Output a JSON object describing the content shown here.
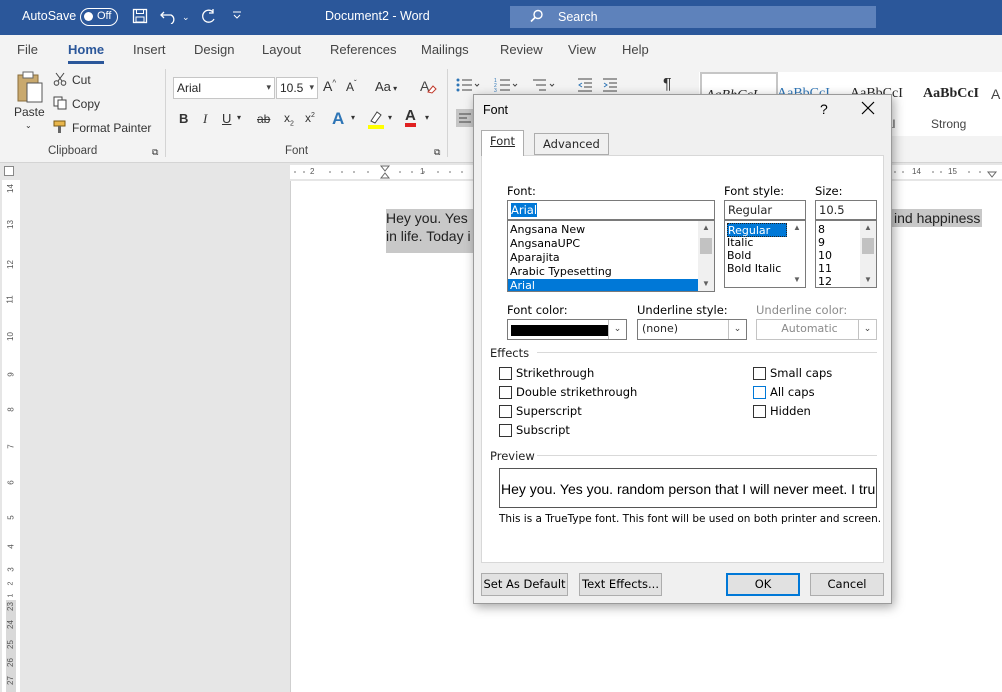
{
  "titlebar": {
    "autosave_label": "AutoSave",
    "autosave_state": "Off",
    "document_title": "Document2  -  Word",
    "search_placeholder": "Search"
  },
  "menu": {
    "tabs": [
      "File",
      "Home",
      "Insert",
      "Design",
      "Layout",
      "References",
      "Mailings",
      "Review",
      "View",
      "Help"
    ],
    "active": "Home"
  },
  "ribbon": {
    "clipboard": {
      "paste": "Paste",
      "cut": "Cut",
      "copy": "Copy",
      "format_painter": "Format Painter",
      "group_label": "Clipboard"
    },
    "font": {
      "font_name": "Arial",
      "font_size": "10.5",
      "change_case": "Aa",
      "group_label": "Font",
      "bold": "B",
      "italic": "I",
      "underline": "U",
      "strikethrough": "ab",
      "subscript": "x",
      "superscript": "x"
    },
    "styles": [
      {
        "sample": "AaBbCcI",
        "name": ""
      },
      {
        "sample": "AaBbCcI",
        "name": ""
      },
      {
        "sample": "AaBbCcI",
        "name": "al"
      },
      {
        "sample": "AaBbCcI",
        "name": "Strong"
      }
    ]
  },
  "ruler": {
    "h_ticks": [
      "2",
      "1",
      "1",
      "14",
      "15"
    ],
    "v_ticks": [
      "14",
      "13",
      "12",
      "11",
      "10",
      "9",
      "8",
      "7",
      "6",
      "5",
      "4",
      "3",
      "2",
      "1",
      "23",
      "24",
      "25",
      "26",
      "27"
    ]
  },
  "document": {
    "line1": "Hey you. Yes",
    "line2": "in life. Today i",
    "line1_right": "ind happiness"
  },
  "dialog": {
    "title": "Font",
    "help": "?",
    "tabs": [
      "Font",
      "Advanced"
    ],
    "font_label": "Font:",
    "font_value": "Arial",
    "font_list": [
      "Angsana New",
      "AngsanaUPC",
      "Aparajita",
      "Arabic Typesetting",
      "Arial"
    ],
    "font_selected": "Arial",
    "style_label": "Font style:",
    "style_value": "Regular",
    "style_list": [
      "Regular",
      "Italic",
      "Bold",
      "Bold Italic"
    ],
    "style_selected": "Regular",
    "size_label": "Size:",
    "size_value": "10.5",
    "size_list": [
      "8",
      "9",
      "10",
      "11",
      "12"
    ],
    "font_color_label": "Font color:",
    "font_color_value": "#000000",
    "underline_style_label": "Underline style:",
    "underline_style_value": "(none)",
    "underline_color_label": "Underline color:",
    "underline_color_value": "Automatic",
    "effects_label": "Effects",
    "effects_left": [
      {
        "label": "Strikethrough",
        "checked": false
      },
      {
        "label": "Double strikethrough",
        "checked": false
      },
      {
        "label": "Superscript",
        "checked": false
      },
      {
        "label": "Subscript",
        "checked": false
      }
    ],
    "effects_right": [
      {
        "label": "Small caps",
        "checked": false
      },
      {
        "label": "All caps",
        "checked": false
      },
      {
        "label": "Hidden",
        "checked": false
      }
    ],
    "preview_label": "Preview",
    "preview_text": "Hey you. Yes you. random person that I will never meet. I tru",
    "preview_note": "This is a TrueType font. This font will be used on both printer and screen.",
    "buttons": {
      "set_default": "Set As Default",
      "text_effects": "Text Effects...",
      "ok": "OK",
      "cancel": "Cancel"
    }
  }
}
